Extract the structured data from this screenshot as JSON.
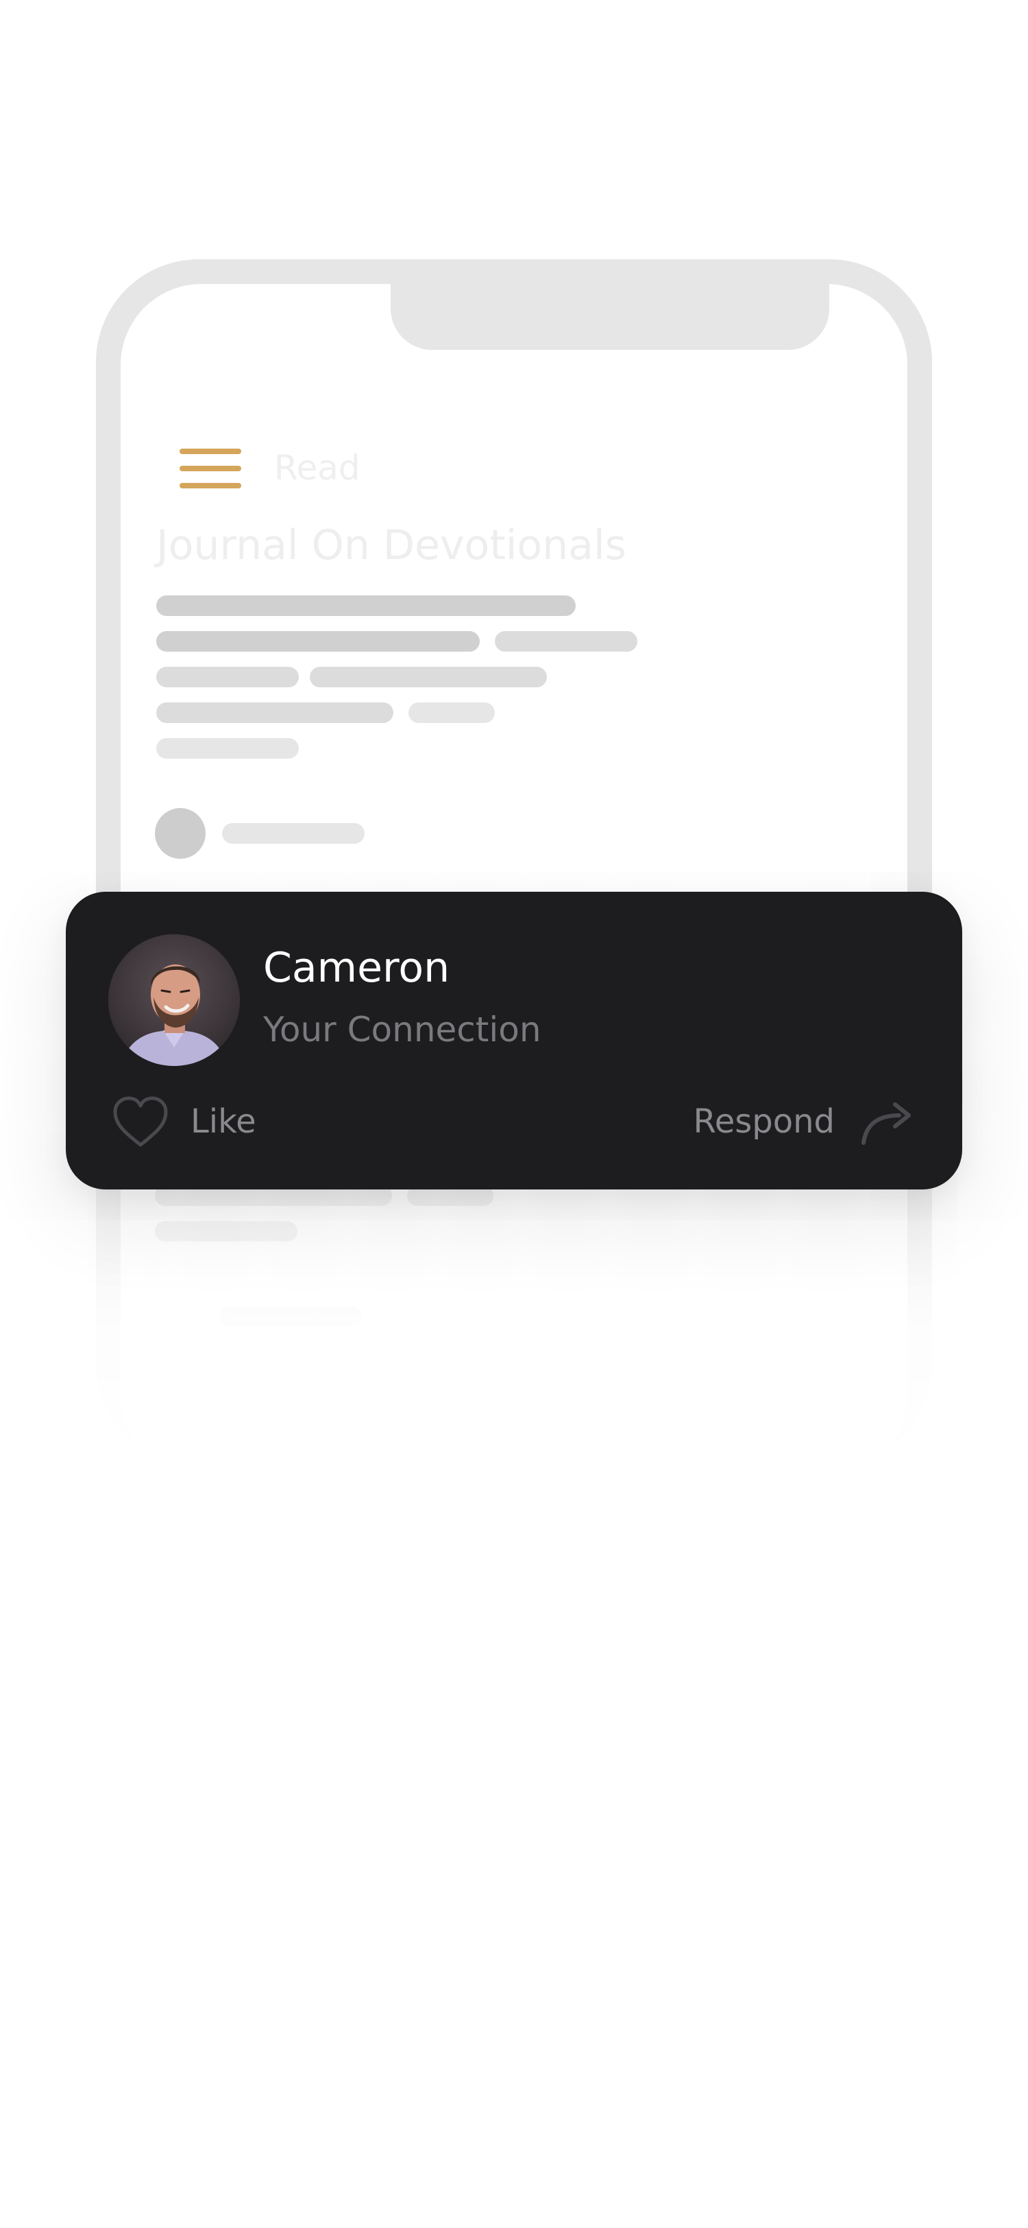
{
  "app": {
    "menu_icon": "hamburger-menu-icon",
    "accent_color": "#d4a55a",
    "tab_label": "Read",
    "page_title": "Journal On Devotionals"
  },
  "notification": {
    "name": "Cameron",
    "subtitle": "Your Connection",
    "avatar_icon": "user-avatar-photo",
    "background_color": "#1d1d1f",
    "actions": {
      "like_label": "Like",
      "like_icon": "heart-outline-icon",
      "respond_label": "Respond",
      "respond_icon": "reply-arrow-icon"
    }
  }
}
